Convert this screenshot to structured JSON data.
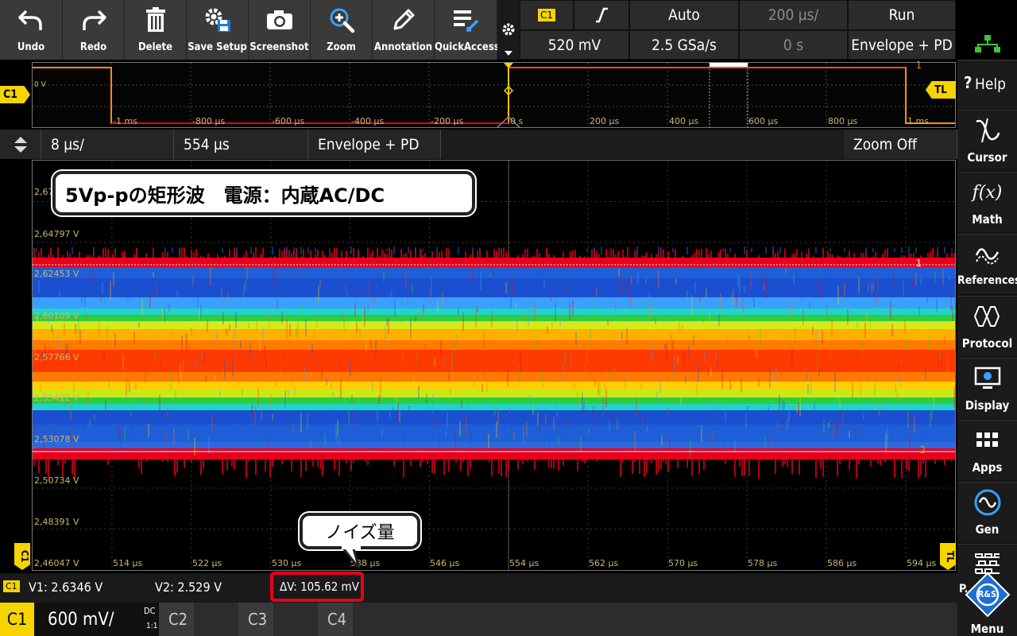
{
  "toolbar": {
    "buttons": [
      {
        "label": "Undo",
        "icon": "undo-icon"
      },
      {
        "label": "Redo",
        "icon": "redo-icon"
      },
      {
        "label": "Delete",
        "icon": "trash-icon"
      },
      {
        "label": "Save Setup",
        "icon": "save-setup-icon"
      },
      {
        "label": "Screenshot",
        "icon": "camera-icon"
      },
      {
        "label": "Zoom",
        "icon": "zoom-icon"
      },
      {
        "label": "Annotation",
        "icon": "pencil-icon"
      },
      {
        "label": "QuickAccess",
        "icon": "quickaccess-icon"
      }
    ]
  },
  "settings": {
    "trigger_source": "C1",
    "trigger_level": "520 mV",
    "trigger_mode": "Auto",
    "sample_rate": "2.5 GSa/s",
    "time_scale": "200 µs/",
    "time_offset": "0 s",
    "run_state": "Run",
    "acq_mode": "Envelope + PD"
  },
  "overview": {
    "zero_label": "0 V",
    "channel_tag": "C1",
    "level_tag": "TL",
    "ticks": [
      "-1 ms",
      "-800 µs",
      "-600 µs",
      "-400 µs",
      "-200 µs",
      "0 s",
      "200 µs",
      "400 µs",
      "600 µs",
      "800 µs",
      "1 ms"
    ]
  },
  "timebar": {
    "zoom_scale": "8 µs/",
    "zoom_position": "554 µs",
    "mode": "Envelope + PD",
    "zoom_state": "Zoom Off"
  },
  "graph": {
    "v_labels": [
      "2,67",
      "2,64797 V",
      "2,62453 V",
      "2,60109 V",
      "2,57766 V",
      "2,55422 V",
      "2,53078 V",
      "2,50734 V",
      "2,48391 V",
      "2,46047 V"
    ],
    "t_labels": [
      "514 µs",
      "522 µs",
      "530 µs",
      "538 µs",
      "546 µs",
      "554 µs",
      "562 µs",
      "570 µs",
      "578 µs",
      "586 µs",
      "594 µs"
    ],
    "cursor1_tag": "1",
    "cursor2_tag": "2",
    "left_tag": "C1",
    "right_tag": "TL"
  },
  "annotations": {
    "title": "5Vp-pの矩形波　電源：内蔵AC/DC",
    "noise": "ノイズ量"
  },
  "cursors": {
    "channel": "C1",
    "v1": "V1: 2.6346 V",
    "v2": "V2: 2.529 V",
    "dv": "ΔV: 105.62 mV"
  },
  "channels": {
    "c1_label": "C1",
    "c1_scale": "600 mV/",
    "c1_coupling": "DC",
    "c1_ratio": "1:1",
    "others": [
      "C2",
      "C3",
      "C4"
    ]
  },
  "side": {
    "help": "Help",
    "cursor": "Cursor",
    "math": "Math",
    "references": "References",
    "protocol": "Protocol",
    "display": "Display",
    "apps": "Apps",
    "gen": "Gen",
    "partial": "P...",
    "menu": "Menu",
    "math_symbol": "f(x)",
    "logo": "R&S"
  },
  "colors": {
    "trace_yellow": "#f5d400",
    "trace_orange": "#ff8c1a",
    "accent_red": "#e8001c",
    "rs_blue": "#1e6fd0"
  }
}
